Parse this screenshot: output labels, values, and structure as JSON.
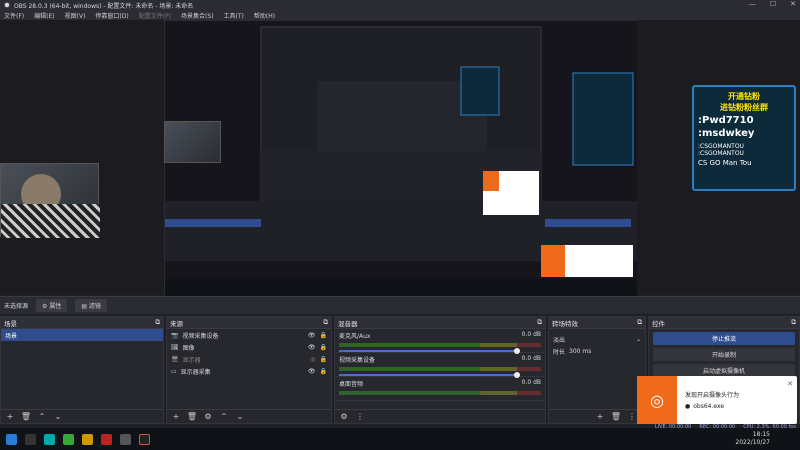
{
  "window": {
    "title": "OBS 28.0.3 (64-bit, windows) - 配置文件: 未命名 - 场景: 未命名",
    "min": "—",
    "max": "☐",
    "close": "✕"
  },
  "menu": [
    "文件(F)",
    "编辑(E)",
    "视图(V)",
    "停靠窗口(D)",
    "配置文件(P)",
    "场景集合(S)",
    "工具(T)",
    "帮助(H)"
  ],
  "scene_strip": {
    "label": "未选择源",
    "props": "属性",
    "filters": "滤镜"
  },
  "scenes": {
    "title": "场景",
    "items": [
      {
        "label": "场景",
        "selected": true
      }
    ]
  },
  "sources": {
    "title": "来源",
    "items": [
      {
        "icon": "camera-icon",
        "label": "视频采集设备"
      },
      {
        "icon": "image-icon",
        "label": "图像"
      },
      {
        "icon": "monitor-icon",
        "label": "显示器"
      },
      {
        "icon": "display-capture-icon",
        "label": "显示器采集"
      }
    ]
  },
  "mixer": {
    "title": "混音器",
    "tracks": [
      {
        "name": "麦克风/Aux",
        "db": "0.0 dB"
      },
      {
        "name": "视频采集设备",
        "db": "0.0 dB"
      },
      {
        "name": "桌面音频",
        "db": "0.0 dB"
      }
    ]
  },
  "transitions": {
    "title": "转场特效",
    "type": "淡出",
    "duration_label": "时长",
    "duration": "300 ms"
  },
  "controls": {
    "title": "控件",
    "stop_stream": "停止推流",
    "start_record": "开始录制",
    "virtual_cam": "启动虚拟摄像机"
  },
  "badge": {
    "line1": "开通钻粉",
    "line2": "进钻粉粉丝群",
    "line3": ":Pwd7710",
    "line4": ":msdwkey",
    "line5": ":CSGOMANTOU",
    "line6": ":CSGOMANTOU",
    "line7": "CS GO Man Tou"
  },
  "popup": {
    "title": "发现开启摄像头行为",
    "item": "obs64.exe",
    "close": "✕"
  },
  "status": {
    "live": "LIVE: 00:00:00",
    "rec": "REC: 00:00:00",
    "cpu": "CPU: 2.3%, 60.00 fps"
  },
  "clock": {
    "time": "18:15",
    "date": "2022/10/27"
  }
}
